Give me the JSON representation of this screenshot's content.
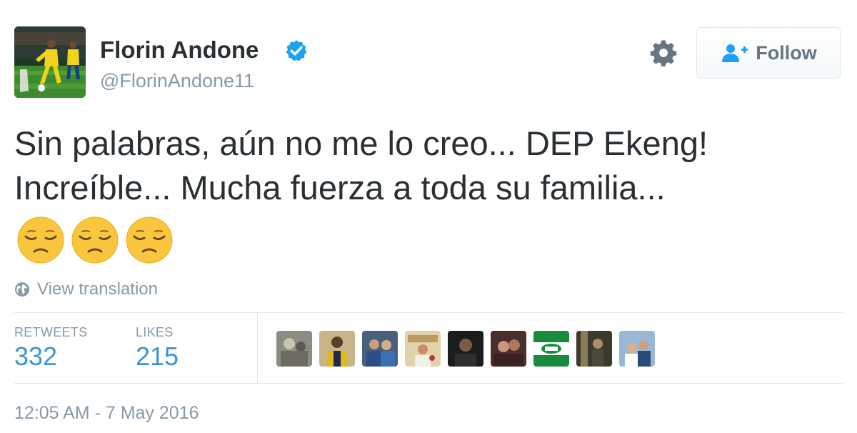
{
  "profile": {
    "display_name": "Florin Andone",
    "handle": "@FlorinAndone11",
    "verified": true,
    "avatar_icon": "player-photo"
  },
  "actions": {
    "settings_icon": "gear-icon",
    "follow_label": "Follow",
    "follow_icon": "add-person-icon"
  },
  "tweet": {
    "line_1": "Sin palabras, aún no me lo creo... DEP Ekeng!",
    "line_2": "Increíble... Mucha fuerza a toda su familia...",
    "emojis": [
      "😔",
      "😔",
      "😔"
    ],
    "translate_label": "View translation",
    "timestamp": "12:05 AM - 7 May 2016"
  },
  "stats": {
    "retweets_label": "RETWEETS",
    "retweets_value": "332",
    "likes_label": "LIKES",
    "likes_value": "215"
  },
  "likers": [
    "liker-avatar",
    "liker-avatar",
    "liker-avatar",
    "liker-avatar",
    "liker-avatar",
    "liker-avatar",
    "liker-avatar",
    "liker-avatar",
    "liker-avatar"
  ],
  "colors": {
    "text": "#292f33",
    "muted": "#8899a6",
    "link_blue": "#3b94d9",
    "verified_blue": "#1da1f2",
    "border": "#e1e8ed"
  }
}
